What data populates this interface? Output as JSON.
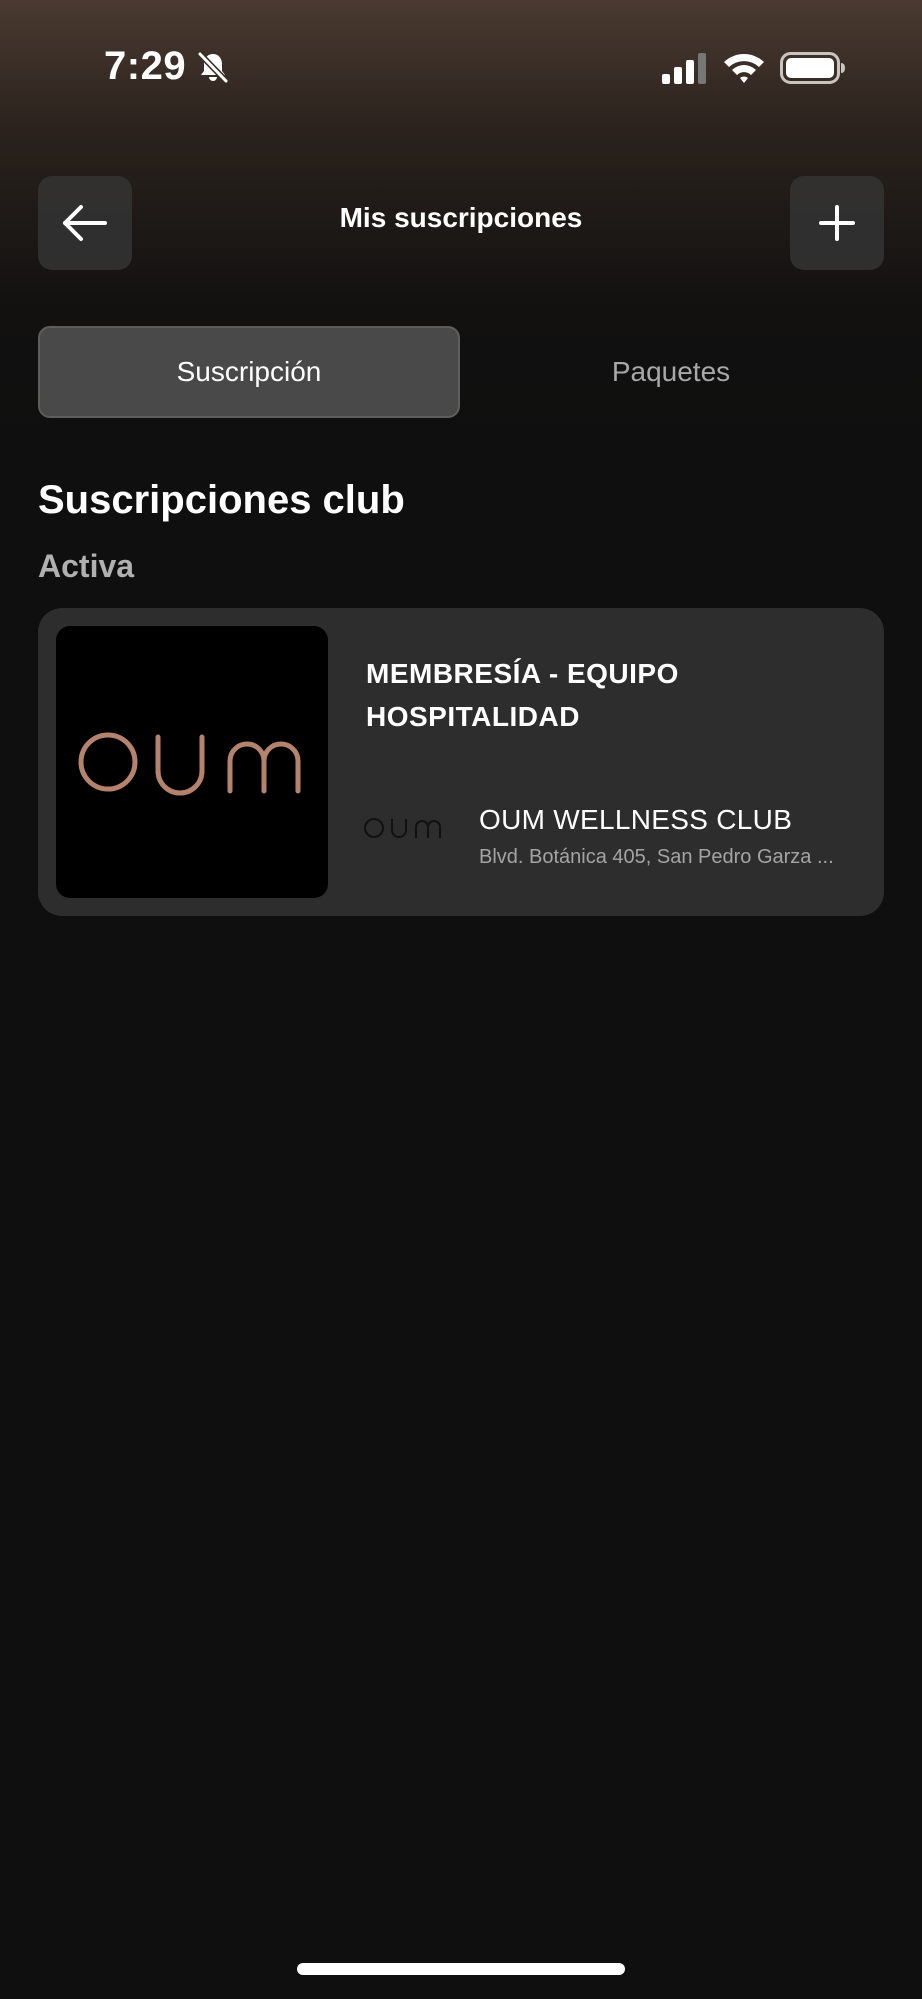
{
  "status_bar": {
    "time": "7:29",
    "icons": [
      "bell-slash-icon",
      "cellular-signal-icon",
      "wifi-icon",
      "battery-icon"
    ]
  },
  "header": {
    "title": "Mis suscripciones",
    "back_icon": "arrow-left-icon",
    "add_icon": "plus-icon"
  },
  "tabs": [
    {
      "label": "Suscripción",
      "active": true
    },
    {
      "label": "Paquetes",
      "active": false
    }
  ],
  "section": {
    "title": "Suscripciones club",
    "status": "Activa"
  },
  "subscriptions": [
    {
      "name": "MEMBRESÍA - EQUIPO HOSPITALIDAD",
      "thumbnail_logo": "oum",
      "club_logo": "oum",
      "club_name": "OUM WELLNESS CLUB",
      "club_address": "Blvd. Botánica 405, San Pedro Garza ..."
    }
  ],
  "colors": {
    "background": "#0f0f0f",
    "card": "#2d2d2d",
    "logo_accent": "#b5836d",
    "tab_active": "#494949"
  }
}
